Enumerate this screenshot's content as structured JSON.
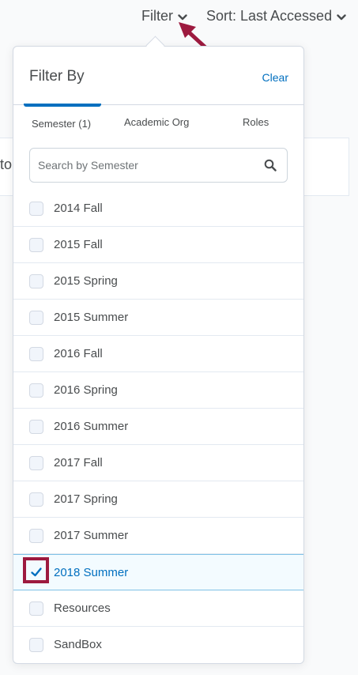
{
  "toolbar": {
    "filter_label": "Filter",
    "sort_label": "Sort: Last Accessed"
  },
  "background": {
    "card_text_fragment": "to"
  },
  "dropdown": {
    "title": "Filter By",
    "clear_label": "Clear",
    "tabs": [
      {
        "label": "Semester (1)",
        "active": true
      },
      {
        "label": "Academic Org",
        "active": false
      },
      {
        "label": "Roles",
        "active": false
      }
    ],
    "search": {
      "placeholder": "Search by Semester",
      "value": ""
    },
    "items": [
      {
        "label": "2014 Fall",
        "checked": false
      },
      {
        "label": "2015 Fall",
        "checked": false
      },
      {
        "label": "2015 Spring",
        "checked": false
      },
      {
        "label": "2015 Summer",
        "checked": false
      },
      {
        "label": "2016 Fall",
        "checked": false
      },
      {
        "label": "2016 Spring",
        "checked": false
      },
      {
        "label": "2016 Summer",
        "checked": false
      },
      {
        "label": "2017 Fall",
        "checked": false
      },
      {
        "label": "2017 Spring",
        "checked": false
      },
      {
        "label": "2017 Summer",
        "checked": false
      },
      {
        "label": "2018 Summer",
        "checked": true
      },
      {
        "label": "Resources",
        "checked": false
      },
      {
        "label": "SandBox",
        "checked": false
      }
    ]
  },
  "colors": {
    "accent": "#006fbf",
    "annotation": "#9d1a3f",
    "text": "#494c4e"
  },
  "icons": {
    "filter_chevron": "chevron-down-icon",
    "sort_chevron": "chevron-down-icon",
    "search": "search-icon",
    "check": "check-icon",
    "annotation_arrow": "arrow-icon"
  }
}
